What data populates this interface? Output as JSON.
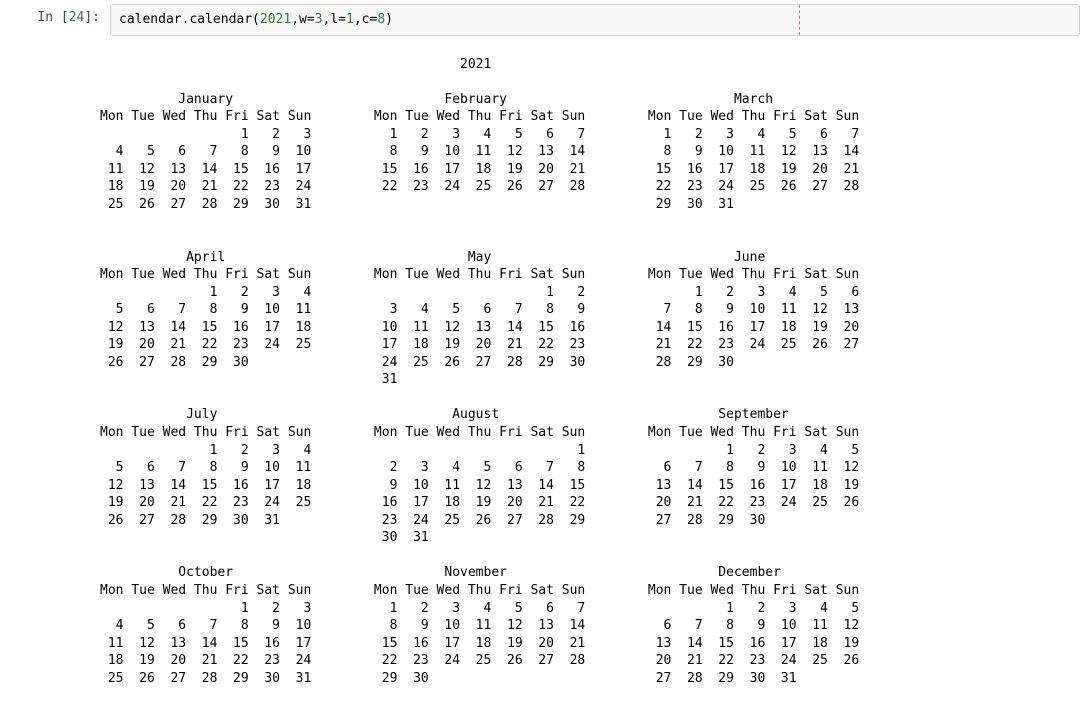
{
  "prompt": {
    "prefix": "In [",
    "number": "24",
    "suffix": "]:"
  },
  "code": {
    "tokens": [
      {
        "t": "calendar.calendar(",
        "cls": "fn"
      },
      {
        "t": "2021",
        "cls": "num"
      },
      {
        "t": ",w=",
        "cls": "kw"
      },
      {
        "t": "3",
        "cls": "num"
      },
      {
        "t": ",l=",
        "cls": "kw"
      },
      {
        "t": "1",
        "cls": "num"
      },
      {
        "t": ",c=",
        "cls": "kw"
      },
      {
        "t": "8",
        "cls": "num"
      },
      {
        "t": ")",
        "cls": "fn"
      }
    ]
  },
  "calendar": {
    "year": "2021",
    "day_header": "Mon Tue Wed Thu Fri Sat Sun",
    "col_sep": "        ",
    "months": [
      {
        "name": "January",
        "weeks": [
          "                  1   2   3",
          "  4   5   6   7   8   9  10",
          " 11  12  13  14  15  16  17",
          " 18  19  20  21  22  23  24",
          " 25  26  27  28  29  30  31",
          "                           "
        ]
      },
      {
        "name": "February",
        "weeks": [
          "  1   2   3   4   5   6   7",
          "  8   9  10  11  12  13  14",
          " 15  16  17  18  19  20  21",
          " 22  23  24  25  26  27  28",
          "                           ",
          "                           "
        ]
      },
      {
        "name": "March",
        "weeks": [
          "  1   2   3   4   5   6   7",
          "  8   9  10  11  12  13  14",
          " 15  16  17  18  19  20  21",
          " 22  23  24  25  26  27  28",
          " 29  30  31                ",
          "                           "
        ]
      },
      {
        "name": "April",
        "weeks": [
          "              1   2   3   4",
          "  5   6   7   8   9  10  11",
          " 12  13  14  15  16  17  18",
          " 19  20  21  22  23  24  25",
          " 26  27  28  29  30        ",
          "                           "
        ]
      },
      {
        "name": "May",
        "weeks": [
          "                      1   2",
          "  3   4   5   6   7   8   9",
          " 10  11  12  13  14  15  16",
          " 17  18  19  20  21  22  23",
          " 24  25  26  27  28  29  30",
          " 31                        "
        ]
      },
      {
        "name": "June",
        "weeks": [
          "      1   2   3   4   5   6",
          "  7   8   9  10  11  12  13",
          " 14  15  16  17  18  19  20",
          " 21  22  23  24  25  26  27",
          " 28  29  30                ",
          "                           "
        ]
      },
      {
        "name": "July",
        "weeks": [
          "              1   2   3   4",
          "  5   6   7   8   9  10  11",
          " 12  13  14  15  16  17  18",
          " 19  20  21  22  23  24  25",
          " 26  27  28  29  30  31    ",
          "                           "
        ]
      },
      {
        "name": "August",
        "weeks": [
          "                          1",
          "  2   3   4   5   6   7   8",
          "  9  10  11  12  13  14  15",
          " 16  17  18  19  20  21  22",
          " 23  24  25  26  27  28  29",
          " 30  31                    "
        ]
      },
      {
        "name": "September",
        "weeks": [
          "          1   2   3   4   5",
          "  6   7   8   9  10  11  12",
          " 13  14  15  16  17  18  19",
          " 20  21  22  23  24  25  26",
          " 27  28  29  30            ",
          "                           "
        ]
      },
      {
        "name": "October",
        "weeks": [
          "                  1   2   3",
          "  4   5   6   7   8   9  10",
          " 11  12  13  14  15  16  17",
          " 18  19  20  21  22  23  24",
          " 25  26  27  28  29  30  31",
          "                           "
        ]
      },
      {
        "name": "November",
        "weeks": [
          "  1   2   3   4   5   6   7",
          "  8   9  10  11  12  13  14",
          " 15  16  17  18  19  20  21",
          " 22  23  24  25  26  27  28",
          " 29  30                    ",
          "                           "
        ]
      },
      {
        "name": "December",
        "weeks": [
          "          1   2   3   4   5",
          "  6   7   8   9  10  11  12",
          " 13  14  15  16  17  18  19",
          " 20  21  22  23  24  25  26",
          " 27  28  29  30  31        ",
          "                           "
        ]
      }
    ]
  }
}
